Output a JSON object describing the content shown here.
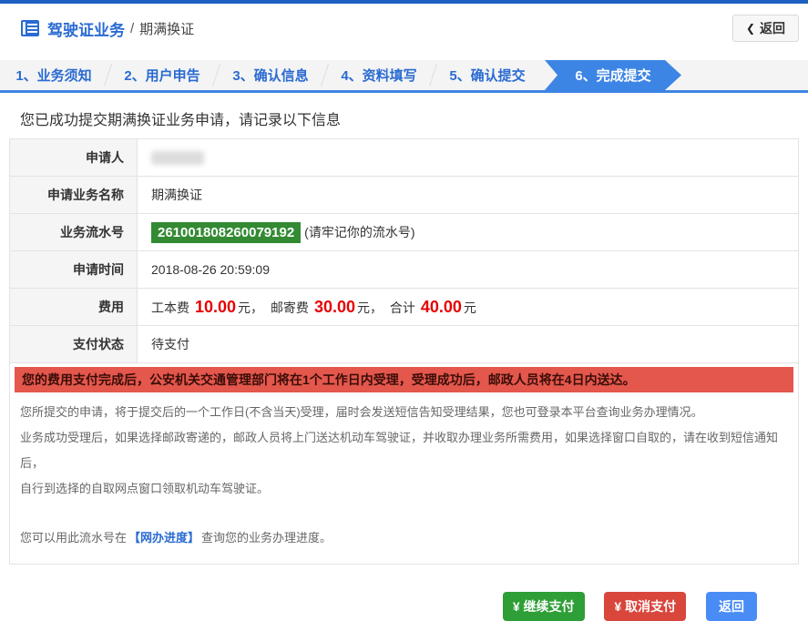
{
  "header": {
    "title_primary": "驾驶证业务",
    "title_separator": "/",
    "title_secondary": "期满换证",
    "back_chevron": "❮",
    "back_label": "返回"
  },
  "steps": {
    "items": [
      {
        "label": "1、业务须知",
        "active": false
      },
      {
        "label": "2、用户申告",
        "active": false
      },
      {
        "label": "3、确认信息",
        "active": false
      },
      {
        "label": "4、资料填写",
        "active": false
      },
      {
        "label": "5、确认提交",
        "active": false
      },
      {
        "label": "6、完成提交",
        "active": true
      }
    ]
  },
  "main": {
    "success_message": "您已成功提交期满换证业务申请，请记录以下信息",
    "table": {
      "rows": [
        {
          "label": "申请人",
          "value": "",
          "redacted": true
        },
        {
          "label": "申请业务名称",
          "value": "期满换证"
        },
        {
          "label": "业务流水号",
          "badge": "261001808260079192",
          "suffix": "(请牢记你的流水号)"
        },
        {
          "label": "申请时间",
          "value": "2018-08-26 20:59:09"
        },
        {
          "label": "费用",
          "value_composite": "工本费 10.00元， 邮寄费 30.00元， 合计 40.00元"
        },
        {
          "label": "支付状态",
          "value": "待支付"
        }
      ]
    },
    "fee": {
      "label1": "工本费",
      "value1": "10.00",
      "unit1": "元，",
      "label2": "邮寄费",
      "value2": "30.00",
      "unit2": "元，",
      "label3": "合计",
      "value3": "40.00",
      "unit3": "元"
    },
    "notice": {
      "banner": "您的费用支付完成后，公安机关交通管理部门将在1个工作日内受理，受理成功后，邮政人员将在4日内送达。",
      "p1": "您所提交的申请，将于提交后的一个工作日(不含当天)受理，届时会发送短信告知受理结果，您也可登录本平台查询业务办理情况。",
      "p2": "业务成功受理后，如果选择邮政寄递的，邮政人员将上门送达机动车驾驶证，并收取办理业务所需费用，如果选择窗口自取的，请在收到短信通知后，",
      "p3": "自行到选择的自取网点窗口领取机动车驾驶证。",
      "p4_prefix": "您可以用此流水号在",
      "p4_link": "【网办进度】",
      "p4_suffix": "查询您的业务办理进度。"
    },
    "actions": {
      "continue_pay": "¥ 继续支付",
      "cancel_pay": "¥ 取消支付",
      "back": "返回"
    }
  },
  "colors": {
    "accent_blue": "#1d60c2",
    "link_blue": "#2a6bd2",
    "step_active_blue": "#3d85e4",
    "serial_badge_green": "#338a33",
    "fee_red": "#e60000",
    "banner_bg": "#e4574c",
    "button_green": "#2e9e36",
    "button_red": "#d9463c",
    "button_blue": "#4a8cf5"
  }
}
